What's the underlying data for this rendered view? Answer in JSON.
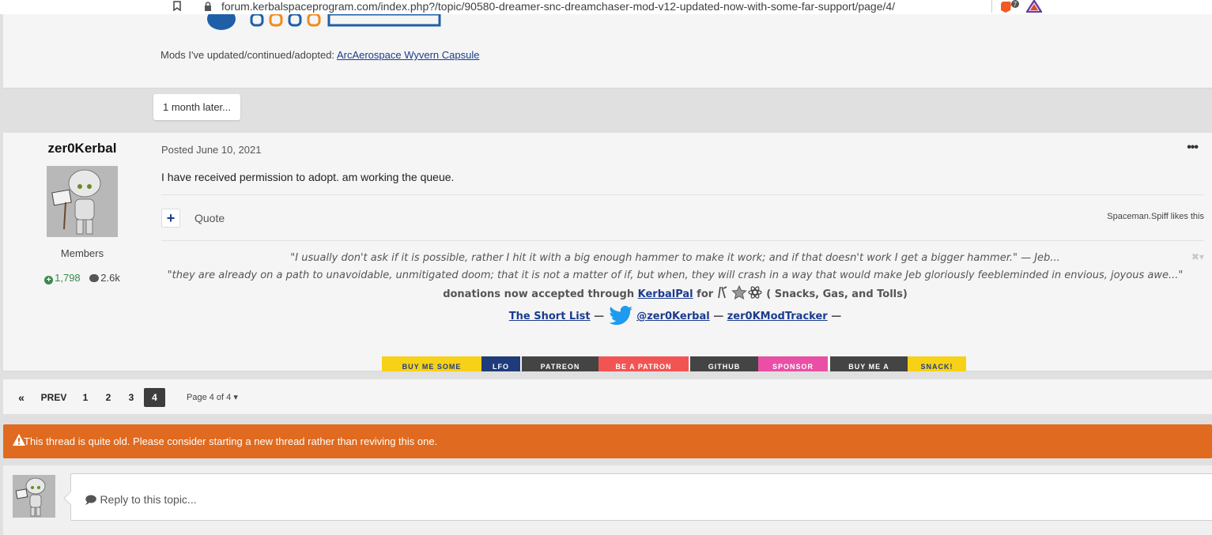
{
  "browser": {
    "url": "forum.kerbalspaceprogram.com/index.php?/topic/90580-dreamer-snc-dreamchaser-mod-v12-updated-now-with-some-far-support/page/4/",
    "ext_badge_count": "7"
  },
  "previous_post": {
    "mods_prefix": "Mods I've updated/continued/adopted: ",
    "mods_link": "ArcAerospace Wyvern Capsule"
  },
  "later_tag": "1 month later...",
  "post": {
    "author": "zer0Kerbal",
    "group": "Members",
    "reputation": "1,798",
    "post_count": "2.6k",
    "posted": "Posted June 10, 2021",
    "body": "I have received permission to adopt. am working the queue.",
    "quote_label": "Quote",
    "likes": "Spaceman.Spiff likes this",
    "signature": {
      "quote1": "\"I usually don't ask if it is possible, rather I hit it with a big enough hammer to make it work; and if that doesn't work I get a bigger hammer.\"  — Jeb...",
      "quote2": "\"they are already on a path to unavoidable, unmitigated doom; that it is not a matter of if, but when, they will crash in a way that would make Jeb gloriously feebleminded in envious, joyous awe...\"",
      "donations_prefix": "donations now accepted through ",
      "donations_link": "KerbalPal",
      "donations_for": " for ",
      "donations_suffix": " ( Snacks, Gas, and Tolls)",
      "short_list": "The Short List",
      "dash1": " — ",
      "twitter_handle": "@zer0Kerbal",
      "dash2": "  — ",
      "tracker": "zer0KModTracker",
      "dash3": " —"
    },
    "badges": [
      {
        "text": "BUY ME SOME",
        "bg": "#f7d116",
        "fg": "#1f3b8c"
      },
      {
        "text": "LFO",
        "bg": "#1f3b7a",
        "fg": "#ffffff"
      },
      {
        "text": "PATREON",
        "bg": "#444444",
        "fg": "#ffffff"
      },
      {
        "text": "BE A PATRON",
        "bg": "#f25454",
        "fg": "#ffffff"
      },
      {
        "text": "GITHUB",
        "bg": "#444444",
        "fg": "#ffffff"
      },
      {
        "text": "SPONSOR",
        "bg": "#e94fa5",
        "fg": "#ffffff"
      },
      {
        "text": "BUY ME A",
        "bg": "#444444",
        "fg": "#ffffff"
      },
      {
        "text": "SNACK!",
        "bg": "#f7d116",
        "fg": "#1f3b8c"
      }
    ]
  },
  "pagination": {
    "first": "«",
    "prev": "PREV",
    "pages": [
      "1",
      "2",
      "3",
      "4"
    ],
    "current": "4",
    "page_of": "Page 4 of 4"
  },
  "warning": "This thread is quite old. Please consider starting a new thread rather than reviving this one.",
  "reply": {
    "placeholder": "Reply to this topic..."
  },
  "colors": {
    "accent": "#1a3c8e",
    "warning": "#e06a1f",
    "reputation": "#3a8a4e"
  }
}
